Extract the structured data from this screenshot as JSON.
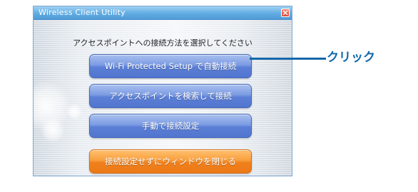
{
  "window": {
    "title": "Wireless Client Utility",
    "close_icon": "close-icon"
  },
  "instruction": "アクセスポイントへの接続方法を選択してください",
  "buttons": {
    "wps": "Wi-Fi Protected Setup で自動接続",
    "search_ap": "アクセスポイントを検索して接続",
    "manual": "手動で接続設定",
    "close_without_setup": "接続設定せずにウィンドウを閉じる"
  },
  "callout": {
    "label": "クリック",
    "color": "#0e67a8"
  },
  "colors": {
    "titlebar": "#61ace3",
    "blue_button": "#5b7fd6",
    "orange_button": "#f0801c"
  }
}
